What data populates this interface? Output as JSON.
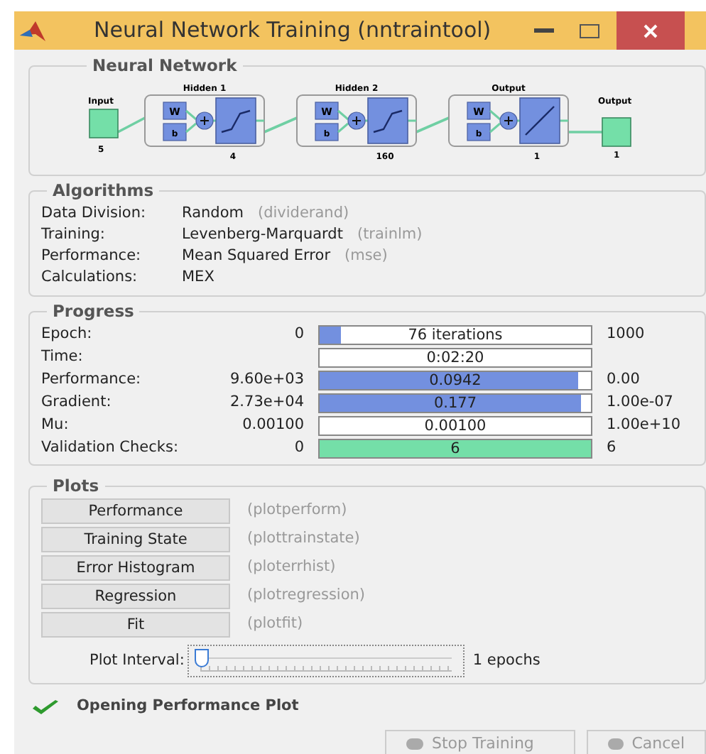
{
  "window": {
    "title": "Neural Network Training (nntraintool)"
  },
  "neural_network": {
    "title": "Neural Network",
    "input": {
      "label": "Input",
      "size": "5"
    },
    "layers": [
      {
        "title": "Hidden 1",
        "size": "4",
        "weight": "W",
        "bias": "b",
        "kind": "sigmoid"
      },
      {
        "title": "Hidden 2",
        "size": "160",
        "weight": "W",
        "bias": "b",
        "kind": "sigmoid"
      },
      {
        "title": "Output",
        "size": "1",
        "weight": "W",
        "bias": "b",
        "kind": "linear"
      }
    ],
    "output": {
      "label": "Output",
      "size": "1"
    }
  },
  "algorithms": {
    "title": "Algorithms",
    "rows": [
      {
        "label": "Data Division:",
        "value": "Random",
        "function": "(dividerand)"
      },
      {
        "label": "Training:",
        "value": "Levenberg-Marquardt",
        "function": "(trainlm)"
      },
      {
        "label": "Performance:",
        "value": "Mean Squared Error",
        "function": "(mse)"
      },
      {
        "label": "Calculations:",
        "value": "MEX"
      }
    ]
  },
  "progress": {
    "title": "Progress",
    "rows": [
      {
        "label": "Epoch:",
        "min": "0",
        "reading": "76 iterations",
        "level": 0.076,
        "color": "#7390df",
        "max": "1000"
      },
      {
        "label": "Time:",
        "reading": "0:02:20"
      },
      {
        "label": "Performance:",
        "min": "9.60e+03",
        "reading": "0.0942",
        "level": 0.955,
        "color": "#7390df",
        "max": "0.00"
      },
      {
        "label": "Gradient:",
        "min": "2.73e+04",
        "reading": "0.177",
        "level": 0.965,
        "color": "#7390df",
        "max": "1.00e-07"
      },
      {
        "label": "Mu:",
        "min": "0.00100",
        "reading": "0.00100",
        "max": "1.00e+10"
      },
      {
        "label": "Validation Checks:",
        "min": "0",
        "reading": "6",
        "level": 1,
        "color": "#74dfa8",
        "max": "6"
      }
    ]
  },
  "plots": {
    "title": "Plots",
    "buttons": [
      {
        "label": "Performance",
        "function": "(plotperform)"
      },
      {
        "label": "Training State",
        "function": "(plottrainstate)"
      },
      {
        "label": "Error Histogram",
        "function": "(ploterrhist)"
      },
      {
        "label": "Regression",
        "function": "(plotregression)"
      },
      {
        "label": "Fit",
        "function": "(plotfit)"
      }
    ],
    "interval": {
      "label": "Plot Interval:",
      "level": 0,
      "reading": "1 epochs"
    }
  },
  "status": {
    "text": "Opening Performance Plot"
  },
  "buttons": [
    {
      "label": "Stop Training",
      "disabled": true
    },
    {
      "label": "Cancel",
      "disabled": true
    }
  ]
}
